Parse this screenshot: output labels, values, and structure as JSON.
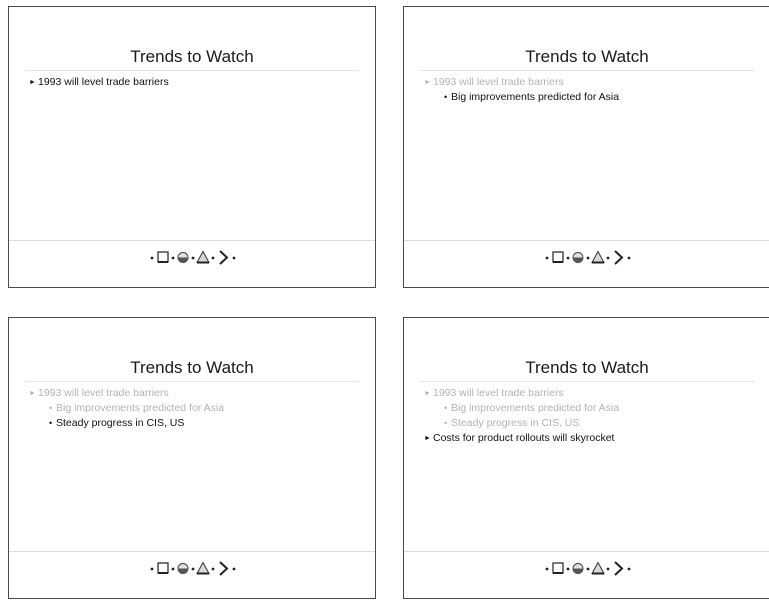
{
  "slides": [
    {
      "title": "Trends to Watch",
      "lines": [
        {
          "text": "1993 will level trade barriers",
          "level": 1,
          "state": "active"
        }
      ],
      "logo": "logo-shapes-icon"
    },
    {
      "title": "Trends to Watch",
      "lines": [
        {
          "text": "1993 will level trade barriers",
          "level": 1,
          "state": "dimmed"
        },
        {
          "text": "Big improvements predicted for Asia",
          "level": 2,
          "state": "active"
        }
      ],
      "logo": "logo-shapes-icon"
    },
    {
      "title": "Trends to Watch",
      "lines": [
        {
          "text": "1993 will level trade barriers",
          "level": 1,
          "state": "dimmed"
        },
        {
          "text": "Big improvements predicted for Asia",
          "level": 2,
          "state": "dimmed"
        },
        {
          "text": "Steady progress in CIS, US",
          "level": 2,
          "state": "active"
        }
      ],
      "logo": "logo-shapes-icon"
    },
    {
      "title": "Trends to Watch",
      "lines": [
        {
          "text": "1993 will level trade barriers",
          "level": 1,
          "state": "dimmed"
        },
        {
          "text": "Big improvements predicted for Asia",
          "level": 2,
          "state": "dimmed"
        },
        {
          "text": "Steady progress in CIS, US",
          "level": 2,
          "state": "dimmed"
        },
        {
          "text": "Costs for product rollouts will skyrocket",
          "level": 1,
          "state": "active"
        }
      ],
      "logo": "logo-shapes-icon"
    }
  ],
  "markers": {
    "level1": "►",
    "level2": "•"
  },
  "colors": {
    "active_text": "#111111",
    "dimmed_text": "#b3b3b3",
    "border": "#4a4a4a"
  }
}
